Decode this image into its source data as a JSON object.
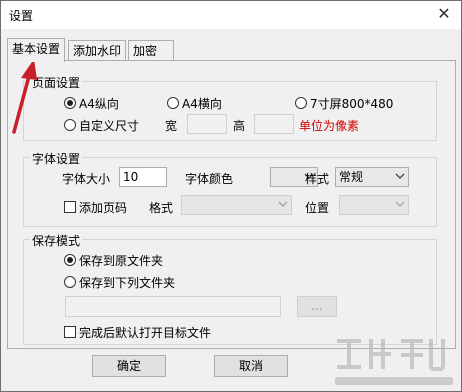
{
  "window": {
    "title": "设置"
  },
  "tabs": [
    {
      "label": "基本设置"
    },
    {
      "label": "添加水印"
    },
    {
      "label": "加密"
    }
  ],
  "page_settings": {
    "legend": "页面设置",
    "options": [
      {
        "label": "A4纵向"
      },
      {
        "label": "A4横向"
      },
      {
        "label": "7寸屏800*480"
      },
      {
        "label": "自定义尺寸"
      }
    ],
    "width_label": "宽",
    "height_label": "高",
    "unit_note": "单位为像素"
  },
  "font_settings": {
    "legend": "字体设置",
    "size_label": "字体大小",
    "size_value": "10",
    "color_label": "字体颜色",
    "style_label": "样式",
    "style_value": "常规",
    "page_number_label": "添加页码",
    "format_label": "格式",
    "position_label": "位置"
  },
  "save_mode": {
    "legend": "保存模式",
    "options": [
      {
        "label": "保存到原文件夹"
      },
      {
        "label": "保存到下列文件夹"
      }
    ],
    "browse_label": "...",
    "open_after_label": "完成后默认打开目标文件"
  },
  "footer": {
    "ok_label": "确定",
    "cancel_label": "取消"
  },
  "colors": {
    "accent_red": "#d00000",
    "arrow": "#c8202a"
  }
}
